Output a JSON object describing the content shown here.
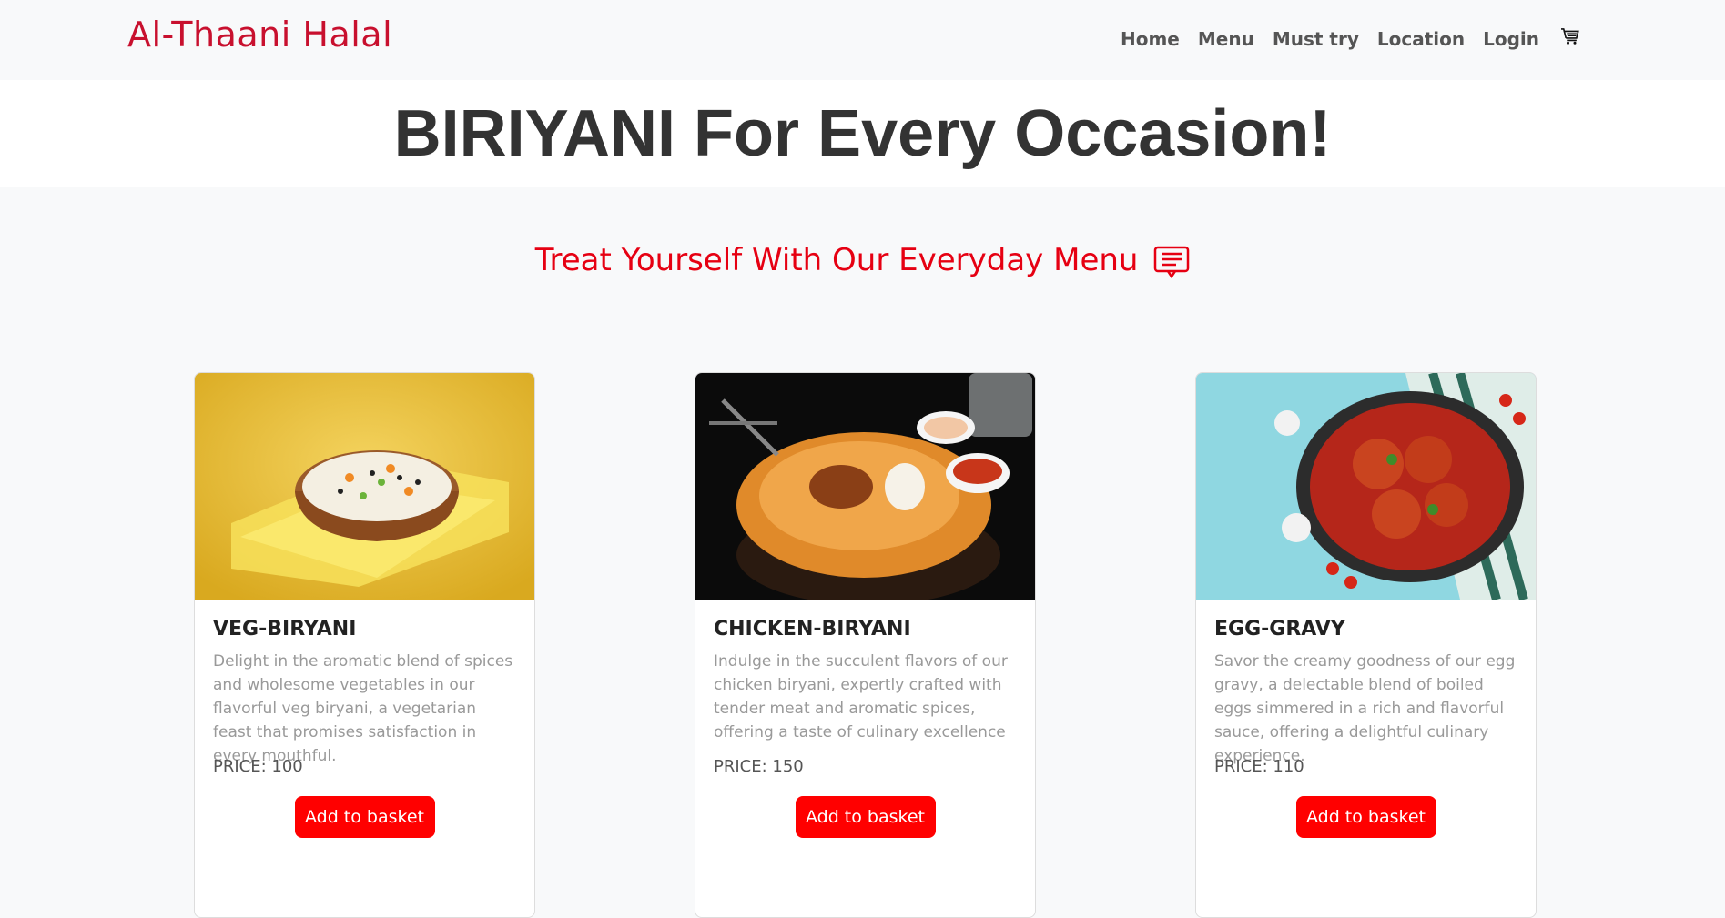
{
  "brand": "Al-Thaani Halal",
  "nav": {
    "home": "Home",
    "menu": "Menu",
    "must_try": "Must try",
    "location": "Location",
    "login": "Login",
    "cart_icon": "cart-icon"
  },
  "hero": {
    "title": "BIRIYANI For Every Occasion!"
  },
  "subtitle": {
    "text": "Treat Yourself With Our Everyday Menu",
    "icon": "menu-card-icon"
  },
  "cards": [
    {
      "title": "VEG-BIRYANI",
      "description": "Delight in the aromatic blend of spices and wholesome vegetables in our flavorful veg biryani, a vegetarian feast that promises satisfaction in every mouthful.",
      "price": "PRICE: 100",
      "button": "Add to basket"
    },
    {
      "title": "CHICKEN-BIRYANI",
      "description": "Indulge in the succulent flavors of our chicken biryani, expertly crafted with tender meat and aromatic spices, offering a taste of culinary excellence",
      "price": "PRICE: 150",
      "button": "Add to basket"
    },
    {
      "title": "EGG-GRAVY",
      "description": "Savor the creamy goodness of our egg gravy, a delectable blend of boiled eggs simmered in a rich and flavorful sauce, offering a delightful culinary experience.",
      "price": "PRICE: 110",
      "button": "Add to basket"
    }
  ],
  "colors": {
    "brand": "#c8102e",
    "accent": "#ff0000"
  }
}
